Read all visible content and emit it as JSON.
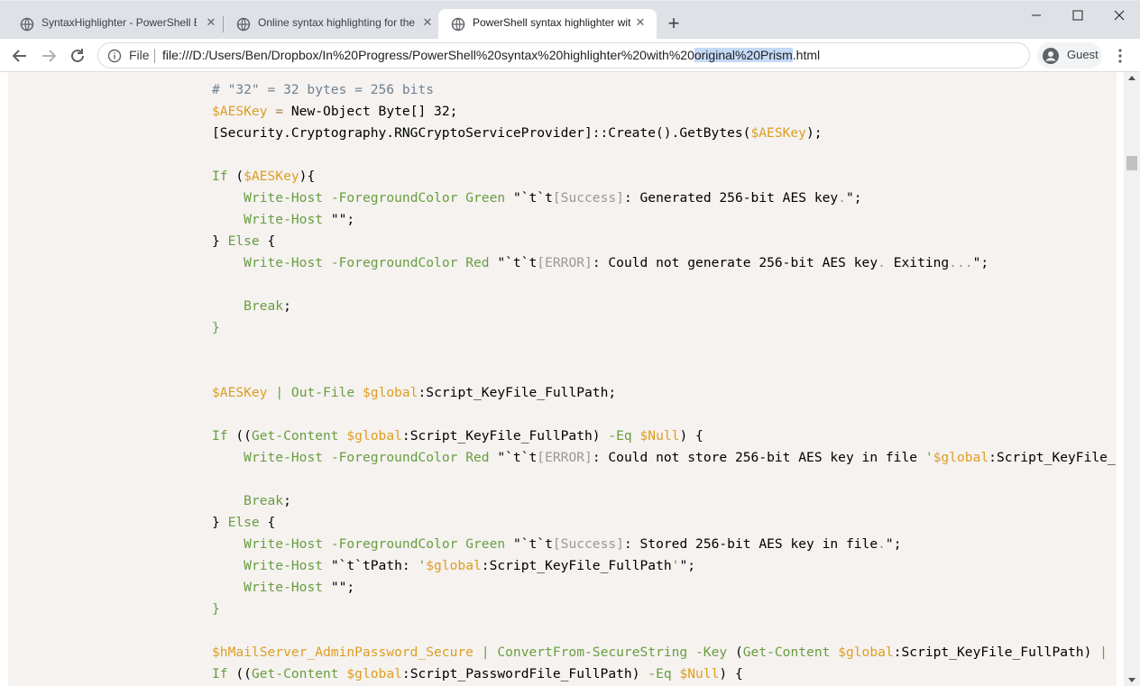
{
  "tabs": [
    {
      "title": "SyntaxHighlighter - PowerShell E",
      "close": "✕"
    },
    {
      "title": "Online syntax highlighting for the",
      "close": "✕"
    },
    {
      "title": "PowerShell syntax highlighter wit",
      "close": "✕"
    }
  ],
  "new_tab": "+",
  "window_controls": {
    "minimize": "–",
    "maximize": "☐",
    "close": "✕"
  },
  "address_bar": {
    "scheme": "File",
    "url_prefix": "file:///D:/Users/Ben/Dropbox/In%20Progress/PowerShell%20syntax%20highlighter%20with%20",
    "url_selected": "original%20Prism",
    "url_suffix": ".html"
  },
  "profile": {
    "label": "Guest"
  },
  "colors": {
    "comment": "#708090",
    "variable": "#dd9e21",
    "function": "#689e3f",
    "keyword": "#3e8fb0",
    "string": "#5c8a2e",
    "code_background": "#f5f2f0"
  },
  "code_lines": [
    [
      [
        "c",
        "# \"32\" = 32 bytes = 256 bits"
      ]
    ],
    [
      [
        "v",
        "$AESKey"
      ],
      [
        "p",
        " "
      ],
      [
        "o",
        "="
      ],
      [
        "p",
        " New-Object Byte[] 32;"
      ]
    ],
    [
      [
        "p",
        "[Security.Cryptography.RNGCryptoServiceProvider]::Create().GetBytes("
      ],
      [
        "v",
        "$AESKey"
      ],
      [
        "p",
        ");"
      ]
    ],
    [],
    [
      [
        "f",
        "If"
      ],
      [
        "p",
        " ("
      ],
      [
        "v",
        "$AESKey"
      ],
      [
        "p",
        "){"
      ]
    ],
    [
      [
        "p",
        "    "
      ],
      [
        "f",
        "Write-Host"
      ],
      [
        "p",
        " "
      ],
      [
        "f",
        "-ForegroundColor"
      ],
      [
        "p",
        " "
      ],
      [
        "f",
        "Green"
      ],
      [
        "p",
        " \"`t`t"
      ],
      [
        "u",
        "[Success]"
      ],
      [
        "p",
        ": Generated 256-bit AES key"
      ],
      [
        "u",
        "."
      ],
      [
        "p",
        "\";"
      ]
    ],
    [
      [
        "p",
        "    "
      ],
      [
        "f",
        "Write-Host"
      ],
      [
        "p",
        " \"\";"
      ]
    ],
    [
      [
        "p",
        "} "
      ],
      [
        "f",
        "Else"
      ],
      [
        "p",
        " {"
      ]
    ],
    [
      [
        "p",
        "    "
      ],
      [
        "f",
        "Write-Host"
      ],
      [
        "p",
        " "
      ],
      [
        "f",
        "-ForegroundColor"
      ],
      [
        "p",
        " "
      ],
      [
        "f",
        "Red"
      ],
      [
        "p",
        " \"`t`t"
      ],
      [
        "u",
        "[ERROR]"
      ],
      [
        "p",
        ": Could not generate 256-bit AES key"
      ],
      [
        "u",
        "."
      ],
      [
        "p",
        " Exiting"
      ],
      [
        "u",
        "..."
      ],
      [
        "p",
        "\";"
      ]
    ],
    [],
    [
      [
        "p",
        "    "
      ],
      [
        "f",
        "Break"
      ],
      [
        "p",
        ";"
      ]
    ],
    [
      [
        "f",
        "}"
      ]
    ],
    [],
    [],
    [
      [
        "v",
        "$AESKey"
      ],
      [
        "p",
        " "
      ],
      [
        "f",
        "|"
      ],
      [
        "p",
        " "
      ],
      [
        "f",
        "Out-File"
      ],
      [
        "p",
        " "
      ],
      [
        "v",
        "$global"
      ],
      [
        "p",
        ":Script_KeyFile_FullPath;"
      ]
    ],
    [],
    [
      [
        "f",
        "If"
      ],
      [
        "p",
        " (("
      ],
      [
        "f",
        "Get-Content"
      ],
      [
        "p",
        " "
      ],
      [
        "v",
        "$global"
      ],
      [
        "p",
        ":Script_KeyFile_FullPath) "
      ],
      [
        "f",
        "-Eq"
      ],
      [
        "p",
        " "
      ],
      [
        "v",
        "$Null"
      ],
      [
        "p",
        ") {"
      ]
    ],
    [
      [
        "p",
        "    "
      ],
      [
        "f",
        "Write-Host"
      ],
      [
        "p",
        " "
      ],
      [
        "f",
        "-ForegroundColor"
      ],
      [
        "p",
        " "
      ],
      [
        "f",
        "Red"
      ],
      [
        "p",
        " \"`t`t"
      ],
      [
        "u",
        "[ERROR]"
      ],
      [
        "p",
        ": Could not store 256-bit AES key in file "
      ],
      [
        "f",
        "'"
      ],
      [
        "v",
        "$global"
      ],
      [
        "p",
        ":Script_KeyFile_"
      ]
    ],
    [],
    [
      [
        "p",
        "    "
      ],
      [
        "f",
        "Break"
      ],
      [
        "p",
        ";"
      ]
    ],
    [
      [
        "p",
        "} "
      ],
      [
        "f",
        "Else"
      ],
      [
        "p",
        " {"
      ]
    ],
    [
      [
        "p",
        "    "
      ],
      [
        "f",
        "Write-Host"
      ],
      [
        "p",
        " "
      ],
      [
        "f",
        "-ForegroundColor"
      ],
      [
        "p",
        " "
      ],
      [
        "f",
        "Green"
      ],
      [
        "p",
        " \"`t`t"
      ],
      [
        "u",
        "[Success]"
      ],
      [
        "p",
        ": Stored 256-bit AES key in file"
      ],
      [
        "u",
        "."
      ],
      [
        "p",
        "\";"
      ]
    ],
    [
      [
        "p",
        "    "
      ],
      [
        "f",
        "Write-Host"
      ],
      [
        "p",
        " \"`t`tPath: "
      ],
      [
        "f",
        "'"
      ],
      [
        "v",
        "$global"
      ],
      [
        "p",
        ":Script_KeyFile_FullPath"
      ],
      [
        "f",
        "'"
      ],
      [
        "p",
        "\";"
      ]
    ],
    [
      [
        "p",
        "    "
      ],
      [
        "f",
        "Write-Host"
      ],
      [
        "p",
        " \"\";"
      ]
    ],
    [
      [
        "f",
        "}"
      ]
    ],
    [],
    [
      [
        "v",
        "$hMailServer_AdminPassword_Secure"
      ],
      [
        "p",
        " "
      ],
      [
        "f",
        "|"
      ],
      [
        "p",
        " "
      ],
      [
        "f",
        "ConvertFrom-SecureString"
      ],
      [
        "p",
        " "
      ],
      [
        "f",
        "-Key"
      ],
      [
        "p",
        " ("
      ],
      [
        "f",
        "Get-Content"
      ],
      [
        "p",
        " "
      ],
      [
        "v",
        "$global"
      ],
      [
        "p",
        ":Script_KeyFile_FullPath) "
      ],
      [
        "f",
        "|"
      ]
    ],
    [
      [
        "f",
        "If"
      ],
      [
        "p",
        " (("
      ],
      [
        "f",
        "Get-Content"
      ],
      [
        "p",
        " "
      ],
      [
        "v",
        "$global"
      ],
      [
        "p",
        ":Script_PasswordFile_FullPath) "
      ],
      [
        "f",
        "-Eq"
      ],
      [
        "p",
        " "
      ],
      [
        "v",
        "$Null"
      ],
      [
        "p",
        ") {"
      ]
    ]
  ]
}
